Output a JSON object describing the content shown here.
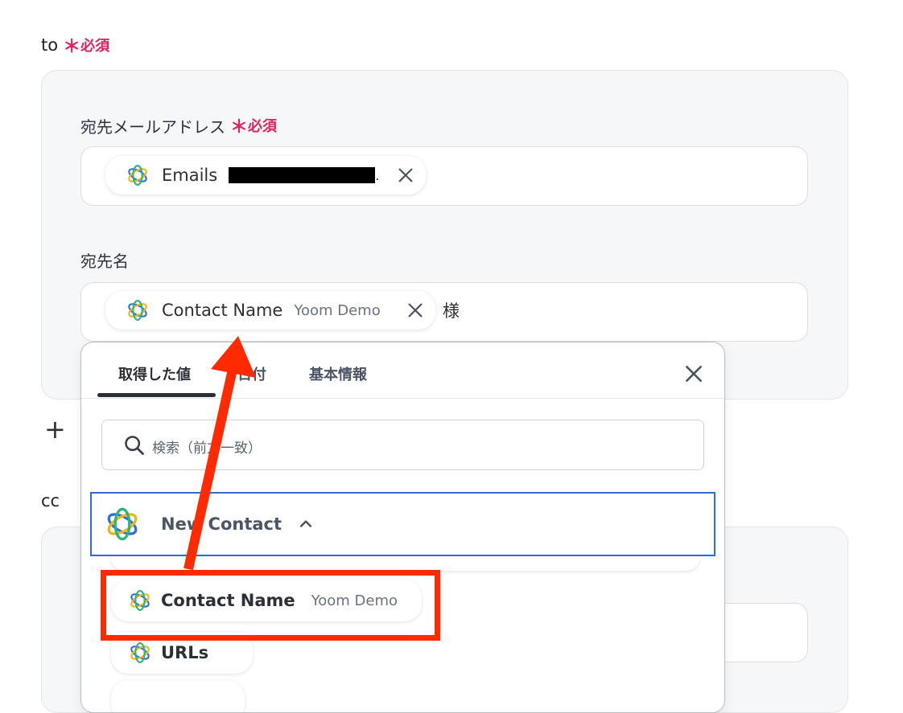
{
  "to_section": {
    "label": "to",
    "required_star": "＊",
    "required_text": "必須"
  },
  "email_field": {
    "label": "宛先メールアドレス",
    "required_star": "＊",
    "required_text": "必須",
    "chip_name": "Emails",
    "chip_suffix": "."
  },
  "recipient_name_field": {
    "label": "宛先名",
    "chip_name": "Contact Name",
    "chip_sub": "Yoom Demo",
    "suffix_text": "様"
  },
  "add_button": {
    "label": "+"
  },
  "cc_section": {
    "label": "cc"
  },
  "dropdown": {
    "tabs": [
      {
        "label": "取得した値",
        "active": true
      },
      {
        "label": "日付",
        "active": false
      },
      {
        "label": "基本情報",
        "active": false
      }
    ],
    "search_placeholder": "検索（前方一致）",
    "group": {
      "label": "New Contact"
    },
    "items": [
      {
        "name": "Contact Name",
        "sub": "Yoom Demo",
        "highlighted": true
      },
      {
        "name": "URLs",
        "sub": ""
      }
    ]
  },
  "colors": {
    "required": "#e0245e",
    "accent_blue": "#2e6bd6",
    "annotation_red": "#ff2a00"
  },
  "icons": [
    "yoom-logo-icon",
    "close-icon",
    "search-icon",
    "chevron-up-icon",
    "plus-icon"
  ]
}
